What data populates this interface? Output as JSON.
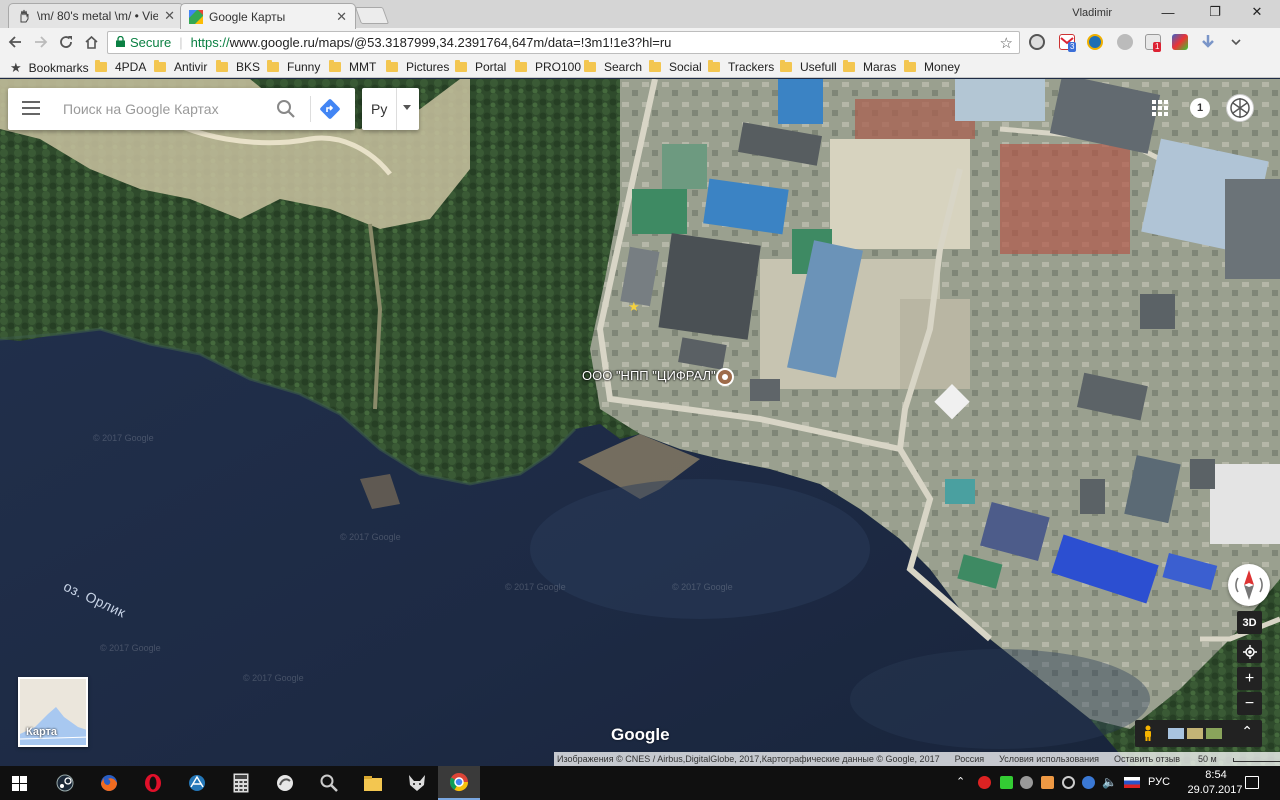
{
  "window": {
    "profile_name": "Vladimir",
    "controls": {
      "minimize": "—",
      "maximize": "❐",
      "close": "✕"
    }
  },
  "tabs": [
    {
      "title": "\\m/ 80's metal \\m/ • Vie",
      "active": false,
      "favicon": "hand-icon"
    },
    {
      "title": "Google Карты",
      "active": true,
      "favicon": "google-maps-icon"
    }
  ],
  "toolbar": {
    "secure_label": "Secure",
    "url_protocol": "https://",
    "url_rest": "www.google.ru/maps/@53.3187999,34.2391764,647m/data=!3m1!1e3?hl=ru"
  },
  "bookmarks": [
    {
      "label": "Bookmarks",
      "icon": "star-icon"
    },
    {
      "label": "4PDA",
      "icon": "folder-icon"
    },
    {
      "label": "Antivir",
      "icon": "folder-icon"
    },
    {
      "label": "BKS",
      "icon": "folder-icon"
    },
    {
      "label": "Funny",
      "icon": "folder-icon"
    },
    {
      "label": "MMT",
      "icon": "folder-icon"
    },
    {
      "label": "Pictures",
      "icon": "folder-icon"
    },
    {
      "label": "Portal",
      "icon": "folder-icon"
    },
    {
      "label": "PRO100",
      "icon": "folder-icon"
    },
    {
      "label": "Search",
      "icon": "folder-icon"
    },
    {
      "label": "Social",
      "icon": "folder-icon"
    },
    {
      "label": "Trackers",
      "icon": "folder-icon"
    },
    {
      "label": "Usefull",
      "icon": "folder-icon"
    },
    {
      "label": "Maras",
      "icon": "folder-icon"
    },
    {
      "label": "Money",
      "icon": "folder-icon"
    }
  ],
  "extensions": {
    "gmail_badge": "3",
    "shield_badge": "1"
  },
  "map": {
    "search_placeholder": "Поиск на Google Картах",
    "language_value": "Ру",
    "notifications_count": "1",
    "place_label": "ООО \"НПП \"ЦИФРАЛ\"",
    "lake_label": "оз. Орлик",
    "watermark": "© 2017 Google",
    "view_3d_label": "3D",
    "zoom_in": "+",
    "zoom_out": "−",
    "minimap_label": "Карта",
    "google_logo": "Google",
    "attribution": "Изображения © CNES / Airbus,DigitalGlobe, 2017,Картографические данные © Google, 2017",
    "region": "Россия",
    "terms": "Условия использования",
    "feedback": "Оставить отзыв",
    "scale": "50 м"
  },
  "taskbar": {
    "apps": [
      "steam-icon",
      "firefox-icon",
      "opera-icon",
      "network-icon",
      "calculator-icon",
      "sound-icon",
      "search-tool-icon",
      "file-explorer-icon",
      "fox-icon",
      "chrome-icon"
    ],
    "language": "РУС",
    "time": "8:54",
    "date": "29.07.2017"
  },
  "colors": {
    "secure_green": "#0b8043",
    "water": "#1e2b45",
    "forest": "#2d4a2b",
    "folder": "#f3c650"
  }
}
